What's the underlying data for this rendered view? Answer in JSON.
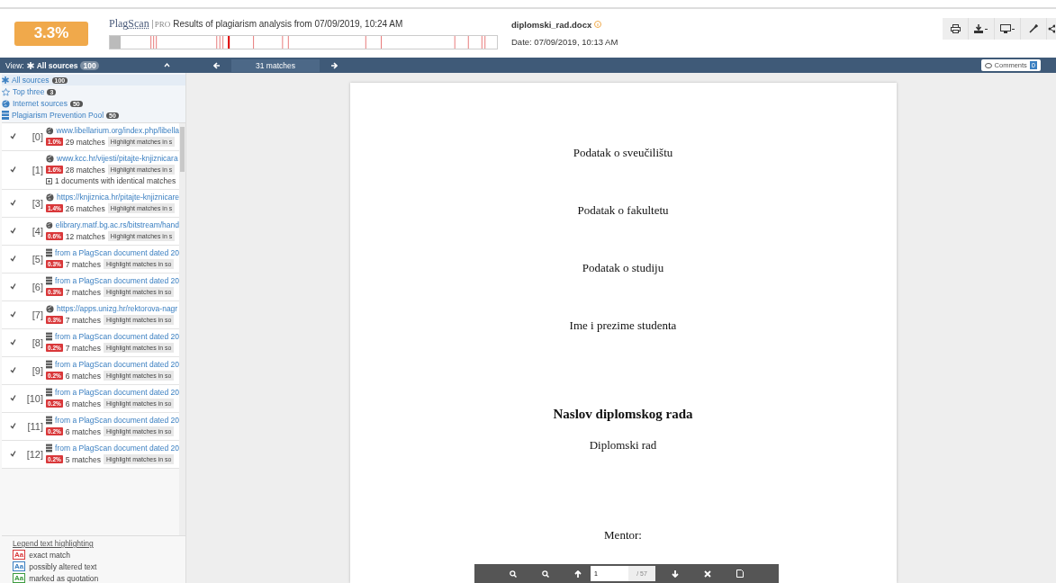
{
  "header": {
    "score": "3.3%",
    "brand": "Plag",
    "brand_2": "Scan",
    "brand_tag": "PRO",
    "results_title": "Results of plagiarism analysis from 07/09/2019, 10:24 AM",
    "file_name": "diplomski_rad.docx",
    "file_date": "Date: 07/09/2019, 10:13 AM"
  },
  "nav": {
    "view_label": "View:",
    "view_value": "All sources",
    "view_count": "100",
    "matches": "31 matches",
    "comments_label": "Comments",
    "comments_count": "0"
  },
  "filters": [
    {
      "kind": "all",
      "label": "All sources",
      "count": "100",
      "selected": true
    },
    {
      "kind": "top",
      "label": "Top three",
      "count": "3",
      "selected": false
    },
    {
      "kind": "internet",
      "label": "Internet sources",
      "count": "50",
      "selected": false
    },
    {
      "kind": "pool",
      "label": "Plagiarism Prevention Pool",
      "count": "50",
      "selected": false
    }
  ],
  "sources": [
    {
      "index": "[0]",
      "kind": "web",
      "link": "www.libellarium.org/index.php/libella",
      "percent": "1.0%",
      "matches": "29 matches",
      "button": "Highlight matches in s",
      "checked": true
    },
    {
      "index": "[1]",
      "kind": "web",
      "link": "www.kcc.hr/vijesti/pitajte-knjiznicara",
      "percent": "1.6%",
      "matches": "28 matches",
      "button": "Highlight matches in s",
      "checked": true,
      "extra": "1 documents with identical matches"
    },
    {
      "index": "[3]",
      "kind": "web",
      "link": "https://knjiznica.hr/pitajte-knjiznicare",
      "percent": "1.4%",
      "matches": "26 matches",
      "button": "Highlight matches in s",
      "checked": true
    },
    {
      "index": "[4]",
      "kind": "web",
      "link": "elibrary.matf.bg.ac.rs/bitstream/hand",
      "percent": "0.6%",
      "matches": "12 matches",
      "button": "Highlight matches in s",
      "checked": true
    },
    {
      "index": "[5]",
      "kind": "pool",
      "link": "from a PlagScan document dated 20",
      "percent": "0.3%",
      "matches": "7 matches",
      "button": "Highlight matches in so",
      "checked": true
    },
    {
      "index": "[6]",
      "kind": "pool",
      "link": "from a PlagScan document dated 20",
      "percent": "0.3%",
      "matches": "7 matches",
      "button": "Highlight matches in so",
      "checked": true
    },
    {
      "index": "[7]",
      "kind": "web",
      "link": "https://apps.unizg.hr/rektorova-nagr",
      "percent": "0.3%",
      "matches": "7 matches",
      "button": "Highlight matches in so",
      "checked": true
    },
    {
      "index": "[8]",
      "kind": "pool",
      "link": "from a PlagScan document dated 20",
      "percent": "0.2%",
      "matches": "7 matches",
      "button": "Highlight matches in so",
      "checked": true
    },
    {
      "index": "[9]",
      "kind": "pool",
      "link": "from a PlagScan document dated 20",
      "percent": "0.2%",
      "matches": "6 matches",
      "button": "Highlight matches in so",
      "checked": true
    },
    {
      "index": "[10]",
      "kind": "pool",
      "link": "from a PlagScan document dated 20",
      "percent": "0.2%",
      "matches": "6 matches",
      "button": "Highlight matches in so",
      "checked": true
    },
    {
      "index": "[11]",
      "kind": "pool",
      "link": "from a PlagScan document dated 20",
      "percent": "0.2%",
      "matches": "6 matches",
      "button": "Highlight matches in so",
      "checked": true
    },
    {
      "index": "[12]",
      "kind": "pool",
      "link": "from a PlagScan document dated 20",
      "percent": "0.2%",
      "matches": "5 matches",
      "button": "Highlight matches in so",
      "checked": true
    }
  ],
  "legend": {
    "title": "Legend text highlighting",
    "items": [
      {
        "sample": "Aa",
        "label": "exact match",
        "color": "#d9383a"
      },
      {
        "sample": "Aa",
        "label": "possibly altered text",
        "color": "#3a7fc1"
      },
      {
        "sample": "Aa",
        "label": "marked as quotation",
        "color": "#3b9a3e"
      }
    ]
  },
  "document": {
    "lines": [
      {
        "text": "Podatak o sveučilištu",
        "bold": false
      },
      {
        "text": "Podatak o fakultetu",
        "bold": false
      },
      {
        "text": "Podatak o studiju",
        "bold": false
      },
      {
        "text": "Ime i prezime studenta",
        "bold": false
      },
      {
        "text": "Naslov diplomskog rada",
        "bold": true
      },
      {
        "text": "Diplomski rad",
        "bold": false
      },
      {
        "text": "Mentor:",
        "bold": false
      }
    ]
  },
  "pager": {
    "page": "1",
    "total": "/ 57"
  }
}
